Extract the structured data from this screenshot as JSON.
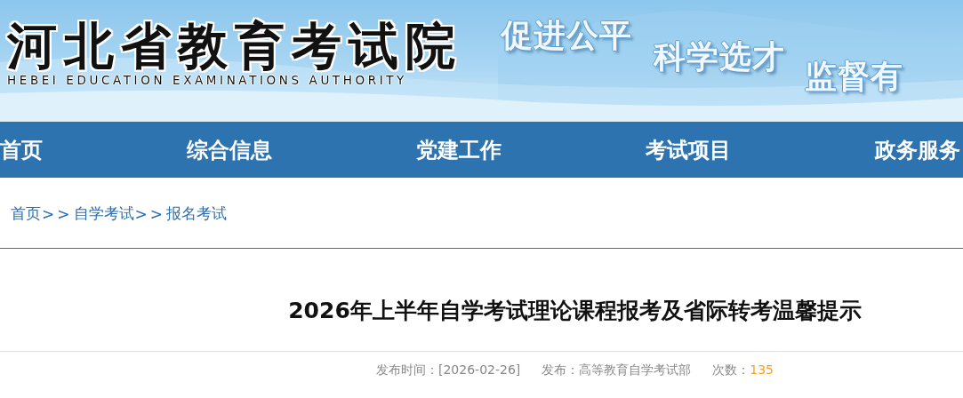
{
  "header": {
    "logo_title": "河北省教育考试院",
    "logo_subtitle": "HEBEI EDUCATION EXAMINATIONS AUTHORITY",
    "slogans": [
      "促进公平",
      "科学选才",
      "监督有"
    ]
  },
  "nav": {
    "items": [
      {
        "label": "首页"
      },
      {
        "label": "综合信息"
      },
      {
        "label": "党建工作"
      },
      {
        "label": "考试项目"
      },
      {
        "label": "政务服务"
      }
    ]
  },
  "breadcrumb": {
    "items": [
      {
        "label": "首页"
      },
      {
        "label": "自学考试"
      },
      {
        "label": "报名考试"
      }
    ],
    "separator": ">>"
  },
  "article": {
    "title": "2026年上半年自学考试理论课程报考及省际转考温馨提示",
    "meta": [
      {
        "kind": "text",
        "label": "发布时间：[2026-02-26]"
      },
      {
        "kind": "text",
        "label": "发布：高等教育自学考试部"
      },
      {
        "kind": "count",
        "label": "次数：",
        "value": "135"
      }
    ]
  }
}
